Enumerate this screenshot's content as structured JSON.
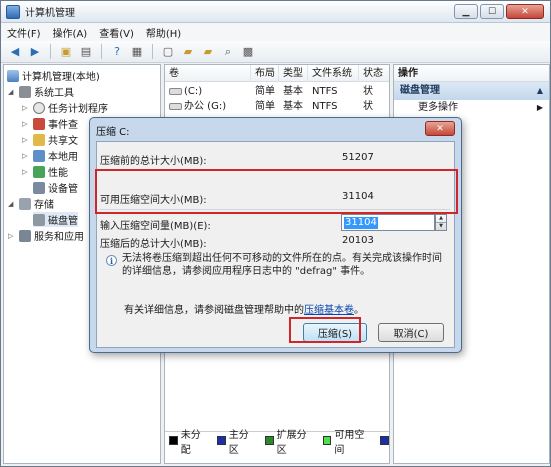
{
  "window": {
    "title": "计算机管理",
    "controls": {
      "minimize": "▁",
      "maximize": "☐",
      "close": "✕"
    }
  },
  "menu": [
    "文件(F)",
    "操作(A)",
    "查看(V)",
    "帮助(H)"
  ],
  "tree": {
    "root": "计算机管理(本地)",
    "items": [
      {
        "label": "系统工具",
        "level": 1,
        "icon": "tools-icon"
      },
      {
        "label": "任务计划程序",
        "level": 2,
        "icon": "clock-icon"
      },
      {
        "label": "事件查",
        "level": 2,
        "icon": "event-viewer-icon"
      },
      {
        "label": "共享文",
        "level": 2,
        "icon": "shared-folder-icon"
      },
      {
        "label": "本地用",
        "level": 2,
        "icon": "users-icon"
      },
      {
        "label": "性能",
        "level": 2,
        "icon": "performance-icon"
      },
      {
        "label": "设备管",
        "level": 2,
        "icon": "device-manager-icon"
      },
      {
        "label": "存储",
        "level": 1,
        "icon": "storage-icon"
      },
      {
        "label": "磁盘管",
        "level": 2,
        "icon": "disk-management-icon"
      },
      {
        "label": "服务和应用",
        "level": 1,
        "icon": "services-icon"
      }
    ]
  },
  "volumes": {
    "columns": [
      "卷",
      "布局",
      "类型",
      "文件系统",
      "状态"
    ],
    "rows": [
      {
        "name": "(C:)",
        "layout": "简单",
        "type": "基本",
        "fs": "NTFS",
        "status": "状"
      },
      {
        "name": "办公 (G:)",
        "layout": "简单",
        "type": "基本",
        "fs": "NTFS",
        "status": "状"
      }
    ]
  },
  "legend": [
    {
      "label": "未分配",
      "color": "#000000"
    },
    {
      "label": "主分区",
      "color": "#1c2fa8"
    },
    {
      "label": "扩展分区",
      "color": "#2a8a2a"
    },
    {
      "label": "可用空间",
      "color": "#4de04d"
    },
    {
      "label": "",
      "color": "#1c2fa8"
    }
  ],
  "actions": {
    "header": "操作",
    "group": "磁盘管理",
    "more": "更多操作"
  },
  "dialog": {
    "title": "压缩 C:",
    "close": "✕",
    "total_label": "压缩前的总计大小(MB):",
    "total_value": "51207",
    "available_label": "可用压缩空间大小(MB):",
    "available_value": "31104",
    "input_label": "输入压缩空间量(MB)(E):",
    "input_value": "31104",
    "after_label": "压缩后的总计大小(MB):",
    "after_value": "20103",
    "info_text": "无法将卷压缩到超出任何不可移动的文件所在的点。有关完成该操作时间的详细信息，请参阅应用程序日志中的 \"defrag\" 事件。",
    "help_prefix": "有关详细信息，请参阅磁盘管理帮助中的",
    "help_link": "压缩基本卷",
    "help_suffix": "。",
    "compress_button": "压缩(S)",
    "cancel_button": "取消(C)"
  }
}
